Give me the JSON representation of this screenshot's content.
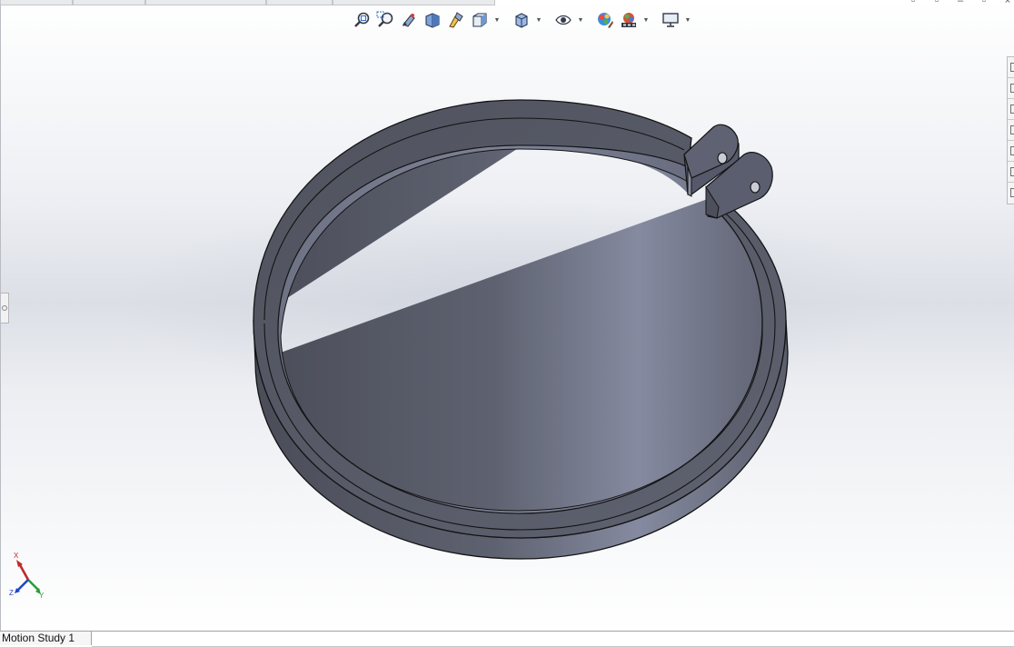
{
  "viewport": {
    "background_top": "#ffffff",
    "background_mid": "#dcdfe6"
  },
  "model": {
    "body_color": "#5c606d",
    "highlight_color": "#8a8ea0",
    "edge_color": "#141414"
  },
  "hud_toolbar": {
    "items": [
      {
        "name": "zoom-to-fit"
      },
      {
        "name": "zoom-to-area"
      },
      {
        "name": "previous-view"
      },
      {
        "name": "section-view"
      },
      {
        "name": "view-selector"
      },
      {
        "name": "view-orientation"
      },
      {
        "name": "display-style"
      },
      {
        "name": "hide-show-items"
      },
      {
        "name": "edit-appearance"
      },
      {
        "name": "apply-scene"
      },
      {
        "name": "view-settings"
      }
    ]
  },
  "triad": {
    "x_label": "X",
    "y_label": "Y",
    "z_label": "Z",
    "x_color": "#c0262b",
    "y_color": "#2a9d3a",
    "z_color": "#2146c7"
  },
  "bottom_tabs": {
    "motion_study": "Motion Study 1"
  }
}
